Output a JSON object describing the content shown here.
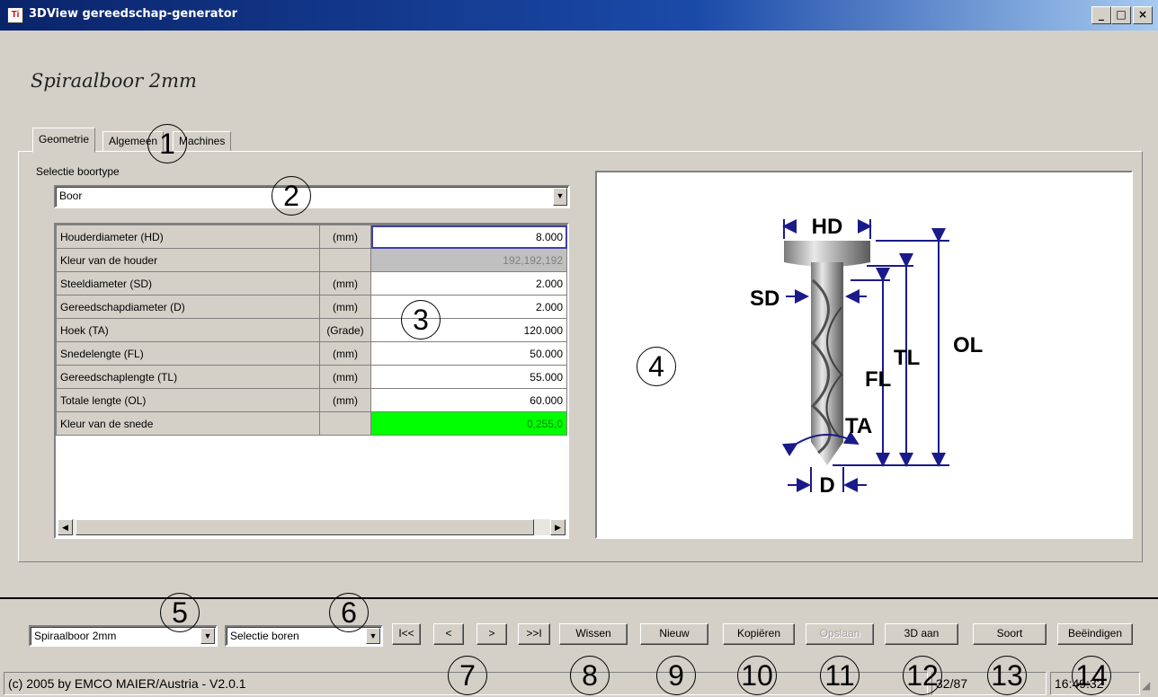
{
  "window": {
    "title": "3DView gereedschap-generator",
    "icon_text": "Ti",
    "minimize": "_",
    "maximize": "□",
    "close": "×"
  },
  "heading": "Spiraalboor 2mm",
  "tabs": [
    {
      "label": "Geometrie",
      "active": true
    },
    {
      "label": "Algemeen",
      "active": false
    },
    {
      "label": "Machines",
      "active": false
    }
  ],
  "selection": {
    "label": "Selectie boortype",
    "value": "Boor"
  },
  "grid": {
    "rows": [
      {
        "name": "Houderdiameter (HD)",
        "unit": "(mm)",
        "value": "8.000"
      },
      {
        "name": "Kleur van de houder",
        "unit": "",
        "value": "192,192,192"
      },
      {
        "name": "Steeldiameter (SD)",
        "unit": "(mm)",
        "value": "2.000"
      },
      {
        "name": "Gereedschapdiameter (D)",
        "unit": "(mm)",
        "value": "2.000"
      },
      {
        "name": "Hoek (TA)",
        "unit": "(Grade)",
        "value": "120.000"
      },
      {
        "name": "Snedelengte (FL)",
        "unit": "(mm)",
        "value": "50.000"
      },
      {
        "name": "Gereedschaplengte (TL)",
        "unit": "(mm)",
        "value": "55.000"
      },
      {
        "name": "Totale lengte (OL)",
        "unit": "(mm)",
        "value": "60.000"
      },
      {
        "name": "Kleur van de snede",
        "unit": "",
        "value": "0,255,0"
      }
    ]
  },
  "diagram": {
    "hd": "HD",
    "sd": "SD",
    "ol": "OL",
    "tl": "TL",
    "fl": "FL",
    "ta": "TA",
    "d": "D"
  },
  "bottom": {
    "tool_combo": "Spiraalboor 2mm",
    "filter_combo": "Selectie boren",
    "nav": {
      "first": "I<<",
      "prev": "<",
      "next": ">",
      "last": ">>I"
    },
    "buttons": {
      "delete": "Wissen",
      "new": "Nieuw",
      "copy": "Kopiëren",
      "save": "Opslaan",
      "view3d": "3D aan",
      "sort": "Soort",
      "exit": "Beëindigen"
    }
  },
  "status": {
    "copyright": "(c) 2005 by EMCO MAIER/Austria -  V2.0.1",
    "record": "32/87",
    "time": "16:49:32"
  },
  "callouts": [
    "1",
    "2",
    "3",
    "4",
    "5",
    "6",
    "7",
    "8",
    "9",
    "10",
    "11",
    "12",
    "13",
    "14"
  ],
  "colors": {
    "title_start": "#0a246a",
    "title_end": "#a6caf0",
    "diagram": "#1a1a8a",
    "holder_color": "#c0c0c0",
    "cutting_color": "#00ff00"
  }
}
